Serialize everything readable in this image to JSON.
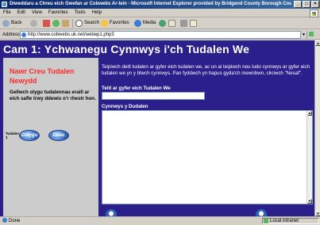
{
  "window": {
    "title": "Diweddaru a Chreu eich Gwefan ar Cobwebs Ar-lein - Microsoft Internet Explorer provided by Bridgend County Borough Council",
    "controls": [
      "_",
      "□",
      "×"
    ]
  },
  "menu": [
    "File",
    "Edit",
    "View",
    "Favorites",
    "Tools",
    "Help"
  ],
  "toolbar": {
    "back": "Back",
    "search": "Search",
    "favorites": "Favorites",
    "media": "Media"
  },
  "address": {
    "label": "Address",
    "url": "http://www.cobwebs.uk.net/webep1.php3",
    "go": "Go"
  },
  "page": {
    "title": "Cam 1: Ychwanegu Cynnwys i'ch Tudalen We",
    "sidebar": {
      "heading": "Nawr Creu Tudalen Newydd",
      "text": "Gellwch olygu tudalennau eraill ar eich safle trwy ddewis o'r rhestr hon.",
      "pages_label": "Tudalen 1",
      "prev_button": "Golygu",
      "next_button": "Dileu"
    },
    "intro": "Teipiwch deitl tudalen ar gyfer eich tudalen we, ac un ai teipiwch neu ludo cynnwys ar gyfer eich tudalen we yn y blwch cynnwys. Pan fyddwch yn hapus gyda'ch mewnbwn, cliciwch \"Nesaf\".",
    "title_label": "Teitl ar gyfer eich Tudalen We",
    "title_value": "",
    "content_label": "Cynnwys y Dudalen",
    "content_value": ""
  },
  "status": {
    "left": "Done",
    "zone": "Local intranet"
  },
  "colors": {
    "page_bg": "#2b1f8c",
    "sidebar_bg": "#cccccc",
    "sidebar_heading": "#ff2a2a"
  }
}
